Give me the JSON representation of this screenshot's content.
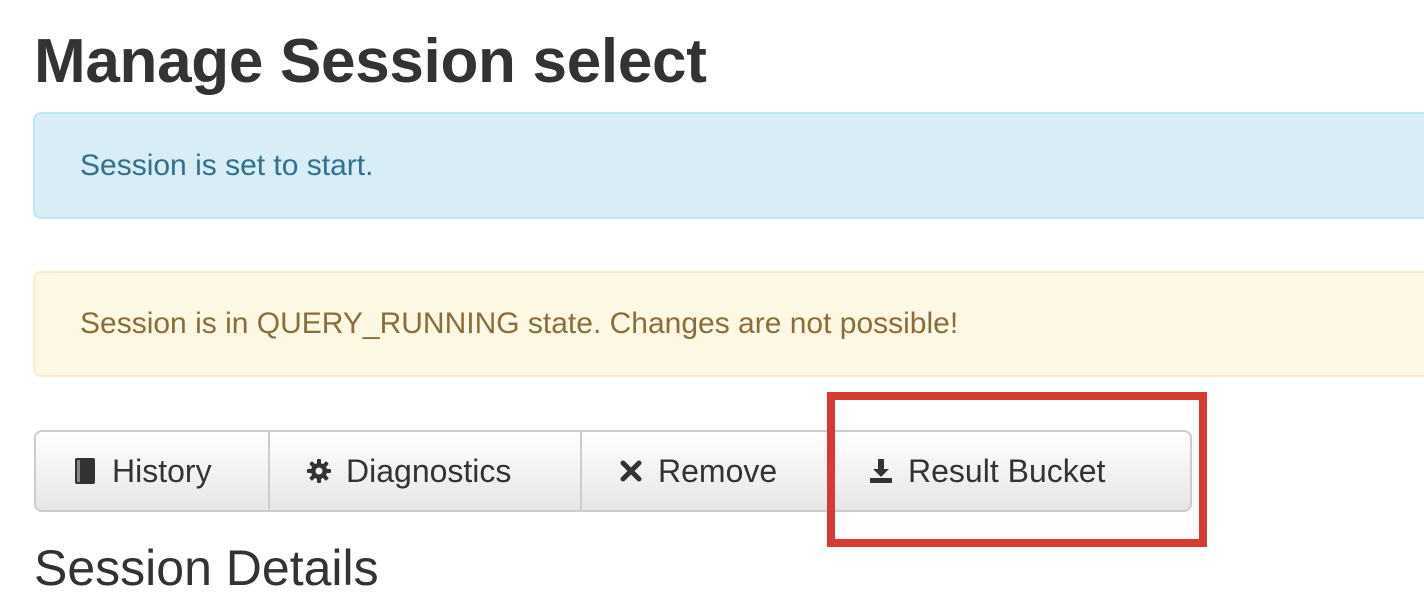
{
  "header": {
    "title": "Manage Session select"
  },
  "alerts": {
    "info": "Session is set to start.",
    "warning": "Session is in QUERY_RUNNING state. Changes are not possible!"
  },
  "toolbar": {
    "buttons": [
      {
        "label": "History",
        "icon": "book-icon"
      },
      {
        "label": "Diagnostics",
        "icon": "gear-icon"
      },
      {
        "label": "Remove",
        "icon": "x-icon"
      },
      {
        "label": "Result Bucket",
        "icon": "download-icon"
      }
    ]
  },
  "section": {
    "title": "Session Details"
  },
  "colors": {
    "info_bg": "#d9edf7",
    "info_text": "#31708f",
    "warning_bg": "#fcf8e3",
    "warning_text": "#8a6d3b",
    "highlight": "#d63a34"
  }
}
